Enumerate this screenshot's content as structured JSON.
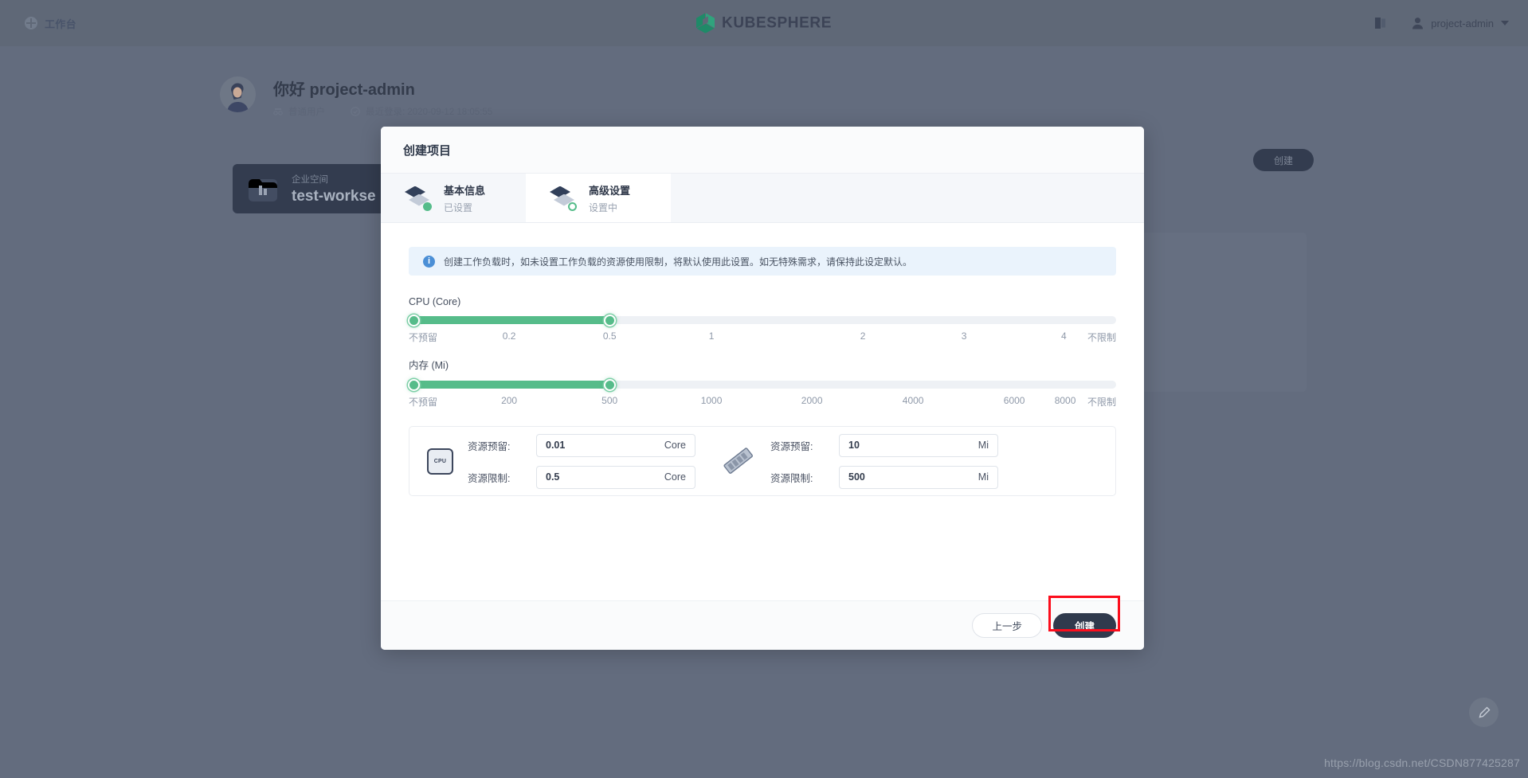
{
  "topnav": {
    "workbench": "工作台",
    "brand": "KUBESPHERE",
    "user": "project-admin",
    "globe_icon": "globe-icon",
    "docs_icon": "docs-book-icon",
    "avatar_icon": "user-avatar-icon",
    "caret_icon": "chevron-down-icon"
  },
  "greeting": {
    "hello": "你好 project-admin",
    "role": "普通用户",
    "last_login": "最近登录: 2020-09-12 18:05:55"
  },
  "workspace": {
    "label": "企业空间",
    "name": "test-workse",
    "create_button": "创建"
  },
  "modal": {
    "title": "创建项目",
    "steps": [
      {
        "title": "基本信息",
        "sub": "已设置",
        "state": "done"
      },
      {
        "title": "高级设置",
        "sub": "设置中",
        "state": "active"
      }
    ],
    "info": "创建工作负载时，如未设置工作负载的资源使用限制，将默认使用此设置。如无特殊需求，请保持此设定默认。",
    "info_icon": "info-circle-icon",
    "sliders": [
      {
        "label": "CPU (Core)",
        "ticks": [
          "不预留",
          "0.2",
          "0.5",
          "1",
          "2",
          "3",
          "4",
          "不限制"
        ],
        "tick_pos": [
          0,
          14.2,
          28.4,
          42.8,
          64.2,
          78.5,
          92.6,
          100
        ],
        "fill_pct": 28.4,
        "handles": [
          0,
          28.4
        ]
      },
      {
        "label": "内存 (Mi)",
        "ticks": [
          "不预留",
          "200",
          "500",
          "1000",
          "2000",
          "4000",
          "6000",
          "8000",
          "不限制"
        ],
        "tick_pos": [
          0,
          14.2,
          28.4,
          42.8,
          57.0,
          71.3,
          85.6,
          92.8,
          100
        ],
        "fill_pct": 28.4,
        "handles": [
          0,
          28.4
        ]
      }
    ],
    "resources": {
      "cpu_icon": "cpu-chip-icon",
      "mem_icon": "memory-stick-icon",
      "cpu": {
        "reserve_label": "资源预留:",
        "reserve_value": "0.01",
        "reserve_unit": "Core",
        "limit_label": "资源限制:",
        "limit_value": "0.5",
        "limit_unit": "Core"
      },
      "memory": {
        "reserve_label": "资源预留:",
        "reserve_value": "10",
        "reserve_unit": "Mi",
        "limit_label": "资源限制:",
        "limit_value": "500",
        "limit_unit": "Mi"
      }
    },
    "footer": {
      "prev": "上一步",
      "create": "创建"
    }
  },
  "watermark": "https://blog.csdn.net/CSDN877425287",
  "fab_icon": "pencil-icon",
  "colors": {
    "accent_green": "#56bc8a",
    "dark_navy": "#303a4d",
    "page_bg": "#636c7e",
    "highlight_red": "#fc0d1c",
    "info_blue": "#eaf3fc"
  }
}
